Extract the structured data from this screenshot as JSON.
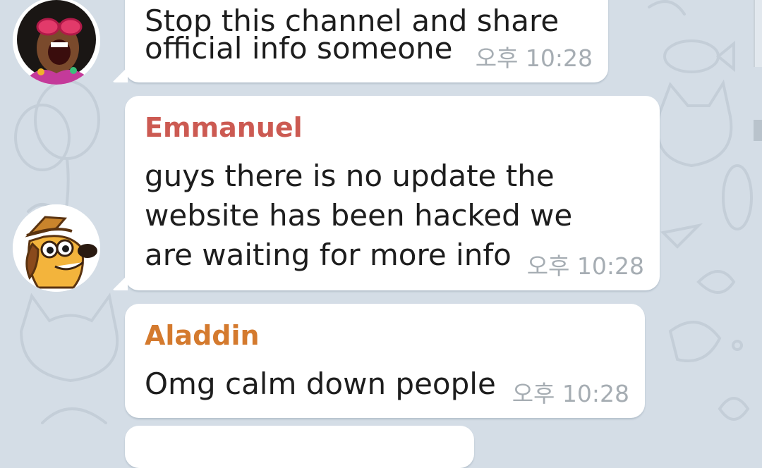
{
  "colors": {
    "background": "#d4dde6",
    "bubble": "#ffffff",
    "emmanuel_name": "#cc5a52",
    "aladdin_name": "#d47a2e",
    "timestamp": "#a6adb3"
  },
  "messages": [
    {
      "sender": "",
      "avatar": "afro-person-avatar",
      "lines": [
        "Stop this channel and share",
        "official info someone"
      ],
      "time": "오후 10:28"
    },
    {
      "sender": "Emmanuel",
      "avatar": "dog-with-hat-avatar",
      "lines": [
        "guys there is no update the",
        "website has been hacked we",
        "are waiting for more info"
      ],
      "time": "오후 10:28"
    },
    {
      "sender": "Aladdin",
      "avatar": "",
      "lines": [
        "Omg calm down people"
      ],
      "time": "오후 10:28"
    }
  ]
}
